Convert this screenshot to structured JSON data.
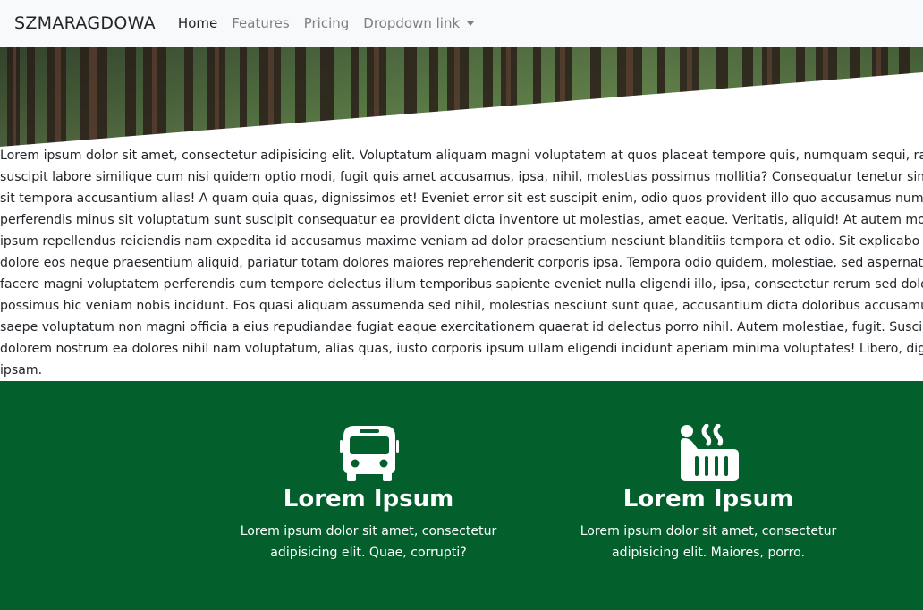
{
  "navbar": {
    "brand": "SZMARAGDOWA",
    "links": [
      {
        "label": "Home",
        "active": true
      },
      {
        "label": "Features",
        "active": false
      },
      {
        "label": "Pricing",
        "active": false
      },
      {
        "label": "Dropdown link",
        "active": false
      }
    ]
  },
  "hero": {
    "image": "forest-photo"
  },
  "content": {
    "lines": [
      "Lorem ipsum dolor sit amet, consectetur adipisicing elit. Voluptatum aliquam magni voluptatem at quos placeat tempore quis, numquam sequi, rat",
      "suscipit labore similique cum nisi quidem optio modi, fugit quis amet accusamus, ipsa, nihil, molestias possimus mollitia? Consequatur tenetur simi",
      "sit tempora accusantium alias! A quam quia quas, dignissimos et! Eveniet error sit est suscipit enim, odio quos provident illo quo accusamus numqu",
      "perferendis minus sit voluptatum sunt suscipit consequatur ea provident dicta inventore ut molestias, amet eaque. Veritatis, aliquid! At autem mole",
      "ipsum repellendus reiciendis nam expedita id accusamus maxime veniam ad dolor praesentium nesciunt blanditiis tempora et odio. Sit explicabo si",
      "dolore eos neque praesentium aliquid, pariatur totam dolores maiores reprehenderit corporis ipsa. Tempora odio quidem, molestiae, sed aspernatu",
      "facere magni voluptatem perferendis cum tempore delectus illum temporibus sapiente eveniet nulla eligendi illo, ipsa, consectetur rerum sed dolor",
      "possimus hic veniam nobis incidunt. Eos quasi aliquam assumenda sed nihil, molestias nesciunt sunt quae, accusantium dicta doloribus accusamus",
      "saepe voluptatum non magni officia a eius repudiandae fugiat eaque exercitationem quaerat id delectus porro nihil. Autem molestiae, fugit. Suscip",
      "dolorem nostrum ea dolores nihil nam voluptatum, alias quas, iusto corporis ipsum ullam eligendi incidunt aperiam minima voluptates! Libero, digr",
      "ipsam."
    ]
  },
  "features": {
    "background": "#035f2c",
    "items": [
      {
        "icon": "bus-icon",
        "title": "Lorem Ipsum",
        "text": "Lorem ipsum dolor sit amet, consectetur adipisicing elit. Quae, corrupti?"
      },
      {
        "icon": "hot-tub-icon",
        "title": "Lorem Ipsum",
        "text": "Lorem ipsum dolor sit amet, consectetur adipisicing elit. Maiores, porro."
      }
    ]
  }
}
